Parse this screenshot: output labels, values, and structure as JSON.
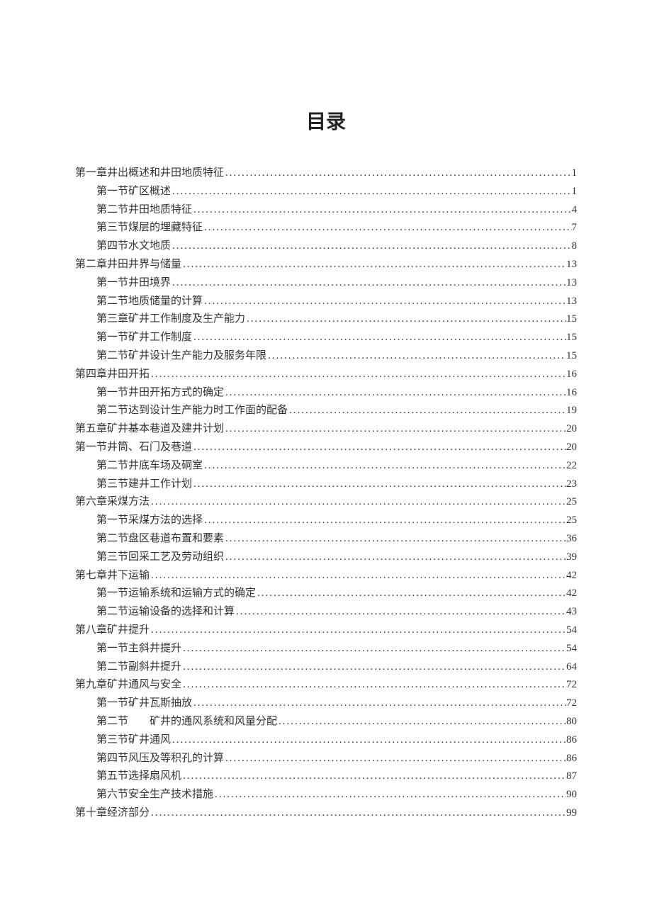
{
  "title": "目录",
  "entries": [
    {
      "level": 0,
      "label": "第一章井出概述和井田地质特征",
      "page": "1"
    },
    {
      "level": 1,
      "label": "第一节矿区概述",
      "page": "1"
    },
    {
      "level": 1,
      "label": "第二节井田地质特征",
      "page": "4"
    },
    {
      "level": 1,
      "label": "第三节煤层的埋藏特征",
      "page": "7"
    },
    {
      "level": 1,
      "label": "第四节水文地质",
      "page": "8"
    },
    {
      "level": 0,
      "label": "第二章井田井界与储量",
      "page": "13"
    },
    {
      "level": 1,
      "label": "第一节井田境界",
      "page": "13"
    },
    {
      "level": 1,
      "label": "第二节地质储量的计算",
      "page": "13"
    },
    {
      "level": 1,
      "label": "第三章矿井工作制度及生产能力",
      "page": "15"
    },
    {
      "level": 1,
      "label": "第一节矿井工作制度",
      "page": "15"
    },
    {
      "level": 1,
      "label": "第二节矿井设计生产能力及服务年限",
      "page": "15"
    },
    {
      "level": 0,
      "label": "第四章井田开拓",
      "page": "16"
    },
    {
      "level": 1,
      "label": "第一节井田开拓方式的确定",
      "page": "16"
    },
    {
      "level": 1,
      "label": "第二节达到设计生产能力时工作面的配备",
      "page": "19"
    },
    {
      "level": 0,
      "label": "第五章矿井基本巷道及建井计划",
      "page": "20"
    },
    {
      "level": 0,
      "label": "第一节井筒、石门及巷道",
      "page": "20"
    },
    {
      "level": 1,
      "label": "第二节井底车场及硐室",
      "page": "22"
    },
    {
      "level": 1,
      "label": "第三节建井工作计划",
      "page": "23"
    },
    {
      "level": 0,
      "label": "第六章采煤方法",
      "page": "25"
    },
    {
      "level": 1,
      "label": "第一节采煤方法的选择",
      "page": "25"
    },
    {
      "level": 1,
      "label": "第二节盘区巷道布置和要素",
      "page": "36"
    },
    {
      "level": 1,
      "label": "第三节回采工艺及劳动组织",
      "page": "39"
    },
    {
      "level": 0,
      "label": "第七章井下运输",
      "page": "42"
    },
    {
      "level": 1,
      "label": "第一节运输系统和运输方式的确定",
      "page": "42"
    },
    {
      "level": 1,
      "label": "第二节运输设备的选择和计算",
      "page": "43"
    },
    {
      "level": 0,
      "label": "第八章矿井提升",
      "page": "54"
    },
    {
      "level": 1,
      "label": "第一节主斜井提升",
      "page": "54"
    },
    {
      "level": 1,
      "label": "第二节副斜井提升",
      "page": "64"
    },
    {
      "level": 0,
      "label": "第九章矿井通风与安全",
      "page": "72"
    },
    {
      "level": 1,
      "label": "第一节矿井瓦斯抽放",
      "page": "72"
    },
    {
      "level": 1,
      "label": "第二节　　矿井的通风系统和风量分配",
      "page": "80"
    },
    {
      "level": 1,
      "label": "第三节矿井通风",
      "page": "86"
    },
    {
      "level": 1,
      "label": "第四节风压及等积孔的计算",
      "page": "86"
    },
    {
      "level": 1,
      "label": "第五节选择扇风机",
      "page": "87"
    },
    {
      "level": 1,
      "label": "第六节安全生产技术措施",
      "page": "90"
    },
    {
      "level": 0,
      "label": "第十章经济部分",
      "page": "99"
    }
  ]
}
